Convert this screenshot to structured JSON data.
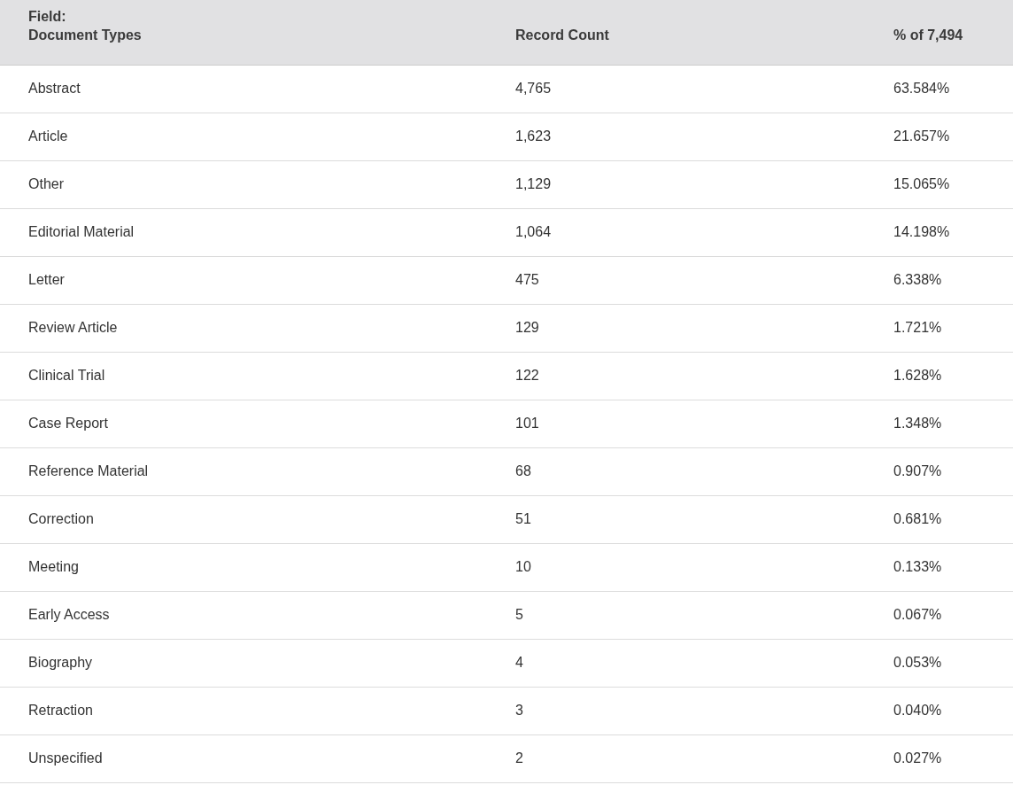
{
  "table": {
    "columns": [
      {
        "prefix": "Field:",
        "label": "Document Types"
      },
      {
        "label": "Record Count"
      },
      {
        "label": "% of 7,494"
      }
    ],
    "rows": [
      [
        "Abstract",
        "4,765",
        "63.584%"
      ],
      [
        "Article",
        "1,623",
        "21.657%"
      ],
      [
        "Other",
        "1,129",
        "15.065%"
      ],
      [
        "Editorial Material",
        "1,064",
        "14.198%"
      ],
      [
        "Letter",
        "475",
        "6.338%"
      ],
      [
        "Review Article",
        "129",
        "1.721%"
      ],
      [
        "Clinical Trial",
        "122",
        "1.628%"
      ],
      [
        "Case Report",
        "101",
        "1.348%"
      ],
      [
        "Reference Material",
        "68",
        "0.907%"
      ],
      [
        "Correction",
        "51",
        "0.681%"
      ],
      [
        "Meeting",
        "10",
        "0.133%"
      ],
      [
        "Early Access",
        "5",
        "0.067%"
      ],
      [
        "Biography",
        "4",
        "0.053%"
      ],
      [
        "Retraction",
        "3",
        "0.040%"
      ],
      [
        "Unspecified",
        "2",
        "0.027%"
      ]
    ]
  }
}
